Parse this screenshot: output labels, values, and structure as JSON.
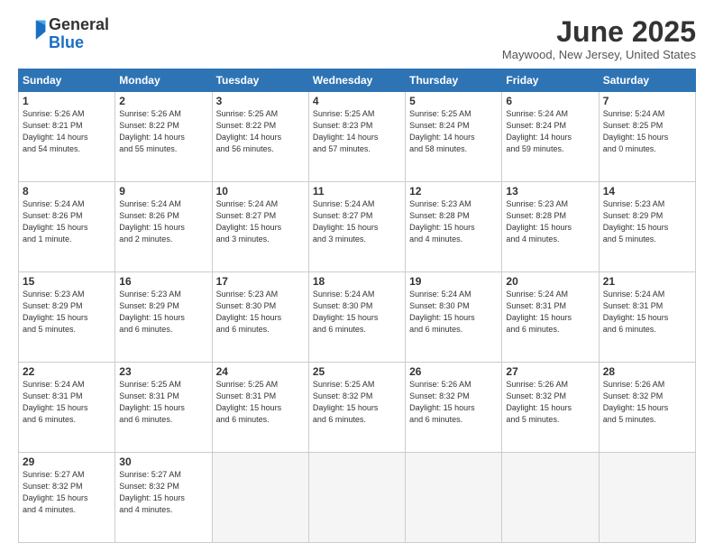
{
  "header": {
    "logo_general": "General",
    "logo_blue": "Blue",
    "month_title": "June 2025",
    "location": "Maywood, New Jersey, United States"
  },
  "weekdays": [
    "Sunday",
    "Monday",
    "Tuesday",
    "Wednesday",
    "Thursday",
    "Friday",
    "Saturday"
  ],
  "days": [
    {
      "num": "",
      "empty": true
    },
    {
      "num": "",
      "empty": true
    },
    {
      "num": "",
      "empty": true
    },
    {
      "num": "",
      "empty": true
    },
    {
      "num": "",
      "empty": true
    },
    {
      "num": "",
      "empty": true
    },
    {
      "num": "7",
      "sunrise": "Sunrise: 5:24 AM",
      "sunset": "Sunset: 8:25 PM",
      "daylight": "Daylight: 15 hours and 0 minutes."
    },
    {
      "num": "1",
      "sunrise": "Sunrise: 5:26 AM",
      "sunset": "Sunset: 8:21 PM",
      "daylight": "Daylight: 14 hours and 54 minutes."
    },
    {
      "num": "2",
      "sunrise": "Sunrise: 5:26 AM",
      "sunset": "Sunset: 8:22 PM",
      "daylight": "Daylight: 14 hours and 55 minutes."
    },
    {
      "num": "3",
      "sunrise": "Sunrise: 5:25 AM",
      "sunset": "Sunset: 8:22 PM",
      "daylight": "Daylight: 14 hours and 56 minutes."
    },
    {
      "num": "4",
      "sunrise": "Sunrise: 5:25 AM",
      "sunset": "Sunset: 8:23 PM",
      "daylight": "Daylight: 14 hours and 57 minutes."
    },
    {
      "num": "5",
      "sunrise": "Sunrise: 5:25 AM",
      "sunset": "Sunset: 8:24 PM",
      "daylight": "Daylight: 14 hours and 58 minutes."
    },
    {
      "num": "6",
      "sunrise": "Sunrise: 5:24 AM",
      "sunset": "Sunset: 8:24 PM",
      "daylight": "Daylight: 14 hours and 59 minutes."
    },
    {
      "num": "14",
      "sunrise": "Sunrise: 5:23 AM",
      "sunset": "Sunset: 8:29 PM",
      "daylight": "Daylight: 15 hours and 5 minutes."
    },
    {
      "num": "8",
      "sunrise": "Sunrise: 5:24 AM",
      "sunset": "Sunset: 8:26 PM",
      "daylight": "Daylight: 15 hours and 1 minute."
    },
    {
      "num": "9",
      "sunrise": "Sunrise: 5:24 AM",
      "sunset": "Sunset: 8:26 PM",
      "daylight": "Daylight: 15 hours and 2 minutes."
    },
    {
      "num": "10",
      "sunrise": "Sunrise: 5:24 AM",
      "sunset": "Sunset: 8:27 PM",
      "daylight": "Daylight: 15 hours and 3 minutes."
    },
    {
      "num": "11",
      "sunrise": "Sunrise: 5:24 AM",
      "sunset": "Sunset: 8:27 PM",
      "daylight": "Daylight: 15 hours and 3 minutes."
    },
    {
      "num": "12",
      "sunrise": "Sunrise: 5:23 AM",
      "sunset": "Sunset: 8:28 PM",
      "daylight": "Daylight: 15 hours and 4 minutes."
    },
    {
      "num": "13",
      "sunrise": "Sunrise: 5:23 AM",
      "sunset": "Sunset: 8:28 PM",
      "daylight": "Daylight: 15 hours and 4 minutes."
    },
    {
      "num": "21",
      "sunrise": "Sunrise: 5:24 AM",
      "sunset": "Sunset: 8:31 PM",
      "daylight": "Daylight: 15 hours and 6 minutes."
    },
    {
      "num": "15",
      "sunrise": "Sunrise: 5:23 AM",
      "sunset": "Sunset: 8:29 PM",
      "daylight": "Daylight: 15 hours and 5 minutes."
    },
    {
      "num": "16",
      "sunrise": "Sunrise: 5:23 AM",
      "sunset": "Sunset: 8:29 PM",
      "daylight": "Daylight: 15 hours and 6 minutes."
    },
    {
      "num": "17",
      "sunrise": "Sunrise: 5:23 AM",
      "sunset": "Sunset: 8:30 PM",
      "daylight": "Daylight: 15 hours and 6 minutes."
    },
    {
      "num": "18",
      "sunrise": "Sunrise: 5:24 AM",
      "sunset": "Sunset: 8:30 PM",
      "daylight": "Daylight: 15 hours and 6 minutes."
    },
    {
      "num": "19",
      "sunrise": "Sunrise: 5:24 AM",
      "sunset": "Sunset: 8:30 PM",
      "daylight": "Daylight: 15 hours and 6 minutes."
    },
    {
      "num": "20",
      "sunrise": "Sunrise: 5:24 AM",
      "sunset": "Sunset: 8:31 PM",
      "daylight": "Daylight: 15 hours and 6 minutes."
    },
    {
      "num": "28",
      "sunrise": "Sunrise: 5:26 AM",
      "sunset": "Sunset: 8:32 PM",
      "daylight": "Daylight: 15 hours and 5 minutes."
    },
    {
      "num": "22",
      "sunrise": "Sunrise: 5:24 AM",
      "sunset": "Sunset: 8:31 PM",
      "daylight": "Daylight: 15 hours and 6 minutes."
    },
    {
      "num": "23",
      "sunrise": "Sunrise: 5:25 AM",
      "sunset": "Sunset: 8:31 PM",
      "daylight": "Daylight: 15 hours and 6 minutes."
    },
    {
      "num": "24",
      "sunrise": "Sunrise: 5:25 AM",
      "sunset": "Sunset: 8:31 PM",
      "daylight": "Daylight: 15 hours and 6 minutes."
    },
    {
      "num": "25",
      "sunrise": "Sunrise: 5:25 AM",
      "sunset": "Sunset: 8:32 PM",
      "daylight": "Daylight: 15 hours and 6 minutes."
    },
    {
      "num": "26",
      "sunrise": "Sunrise: 5:26 AM",
      "sunset": "Sunset: 8:32 PM",
      "daylight": "Daylight: 15 hours and 6 minutes."
    },
    {
      "num": "27",
      "sunrise": "Sunrise: 5:26 AM",
      "sunset": "Sunset: 8:32 PM",
      "daylight": "Daylight: 15 hours and 5 minutes."
    },
    {
      "num": "",
      "empty": true
    },
    {
      "num": "29",
      "sunrise": "Sunrise: 5:27 AM",
      "sunset": "Sunset: 8:32 PM",
      "daylight": "Daylight: 15 hours and 4 minutes."
    },
    {
      "num": "30",
      "sunrise": "Sunrise: 5:27 AM",
      "sunset": "Sunset: 8:32 PM",
      "daylight": "Daylight: 15 hours and 4 minutes."
    },
    {
      "num": "",
      "empty": true
    },
    {
      "num": "",
      "empty": true
    },
    {
      "num": "",
      "empty": true
    },
    {
      "num": "",
      "empty": true
    },
    {
      "num": "",
      "empty": true
    }
  ]
}
